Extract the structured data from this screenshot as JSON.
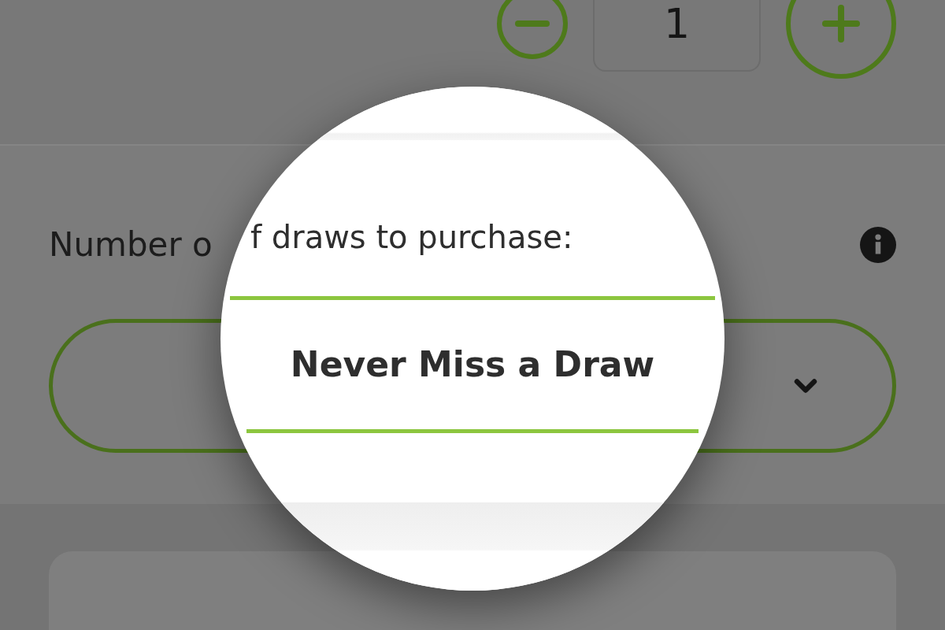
{
  "quantity": {
    "value": "1"
  },
  "draws": {
    "label": "Number o"
  },
  "magnifier": {
    "label": "f draws to purchase:",
    "option": "Never Miss a Draw"
  }
}
